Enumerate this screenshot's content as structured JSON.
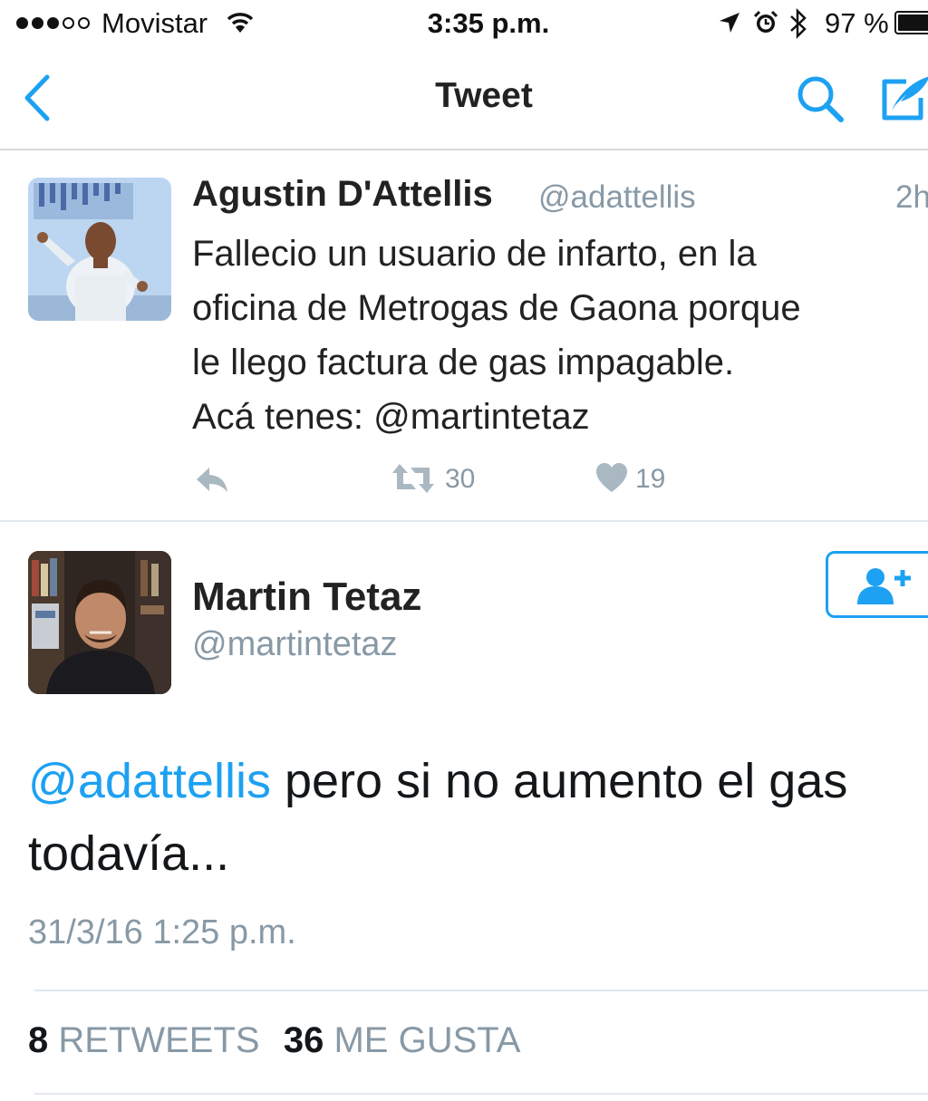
{
  "status_bar": {
    "carrier": "Movistar",
    "time": "3:35 p.m.",
    "battery_percent": "97 %",
    "signal_bars_filled": 3,
    "signal_bars_total": 5
  },
  "nav": {
    "title": "Tweet"
  },
  "parent_tweet": {
    "author_name": "Agustin D'Attellis",
    "author_handle": "@adattellis",
    "time_ago": "2h",
    "text": "Fallecio un usuario de infarto, en la\noficina de Metrogas de Gaona porque\nle llego factura de gas impagable.\nAcá tenes: @martintetaz",
    "retweet_count": "30",
    "like_count": "19"
  },
  "main_tweet": {
    "author_name": "Martin Tetaz",
    "author_handle": "@martintetaz",
    "mention": "@adattellis",
    "text": " pero si no aumento el gas todavía...",
    "timestamp": "31/3/16 1:25 p.m.",
    "retweets_count": "8",
    "retweets_label": "RETWEETS",
    "likes_count": "36",
    "likes_label": "ME GUSTA"
  },
  "colors": {
    "accent": "#1da1f2",
    "secondary_text": "#8899a6",
    "divider": "#e1e8ed"
  },
  "icons": {
    "back": "chevron-left-icon",
    "search": "search-icon",
    "compose": "compose-tweet-icon",
    "reply": "reply-icon",
    "retweet": "retweet-icon",
    "like": "heart-icon",
    "follow": "follow-user-icon"
  }
}
